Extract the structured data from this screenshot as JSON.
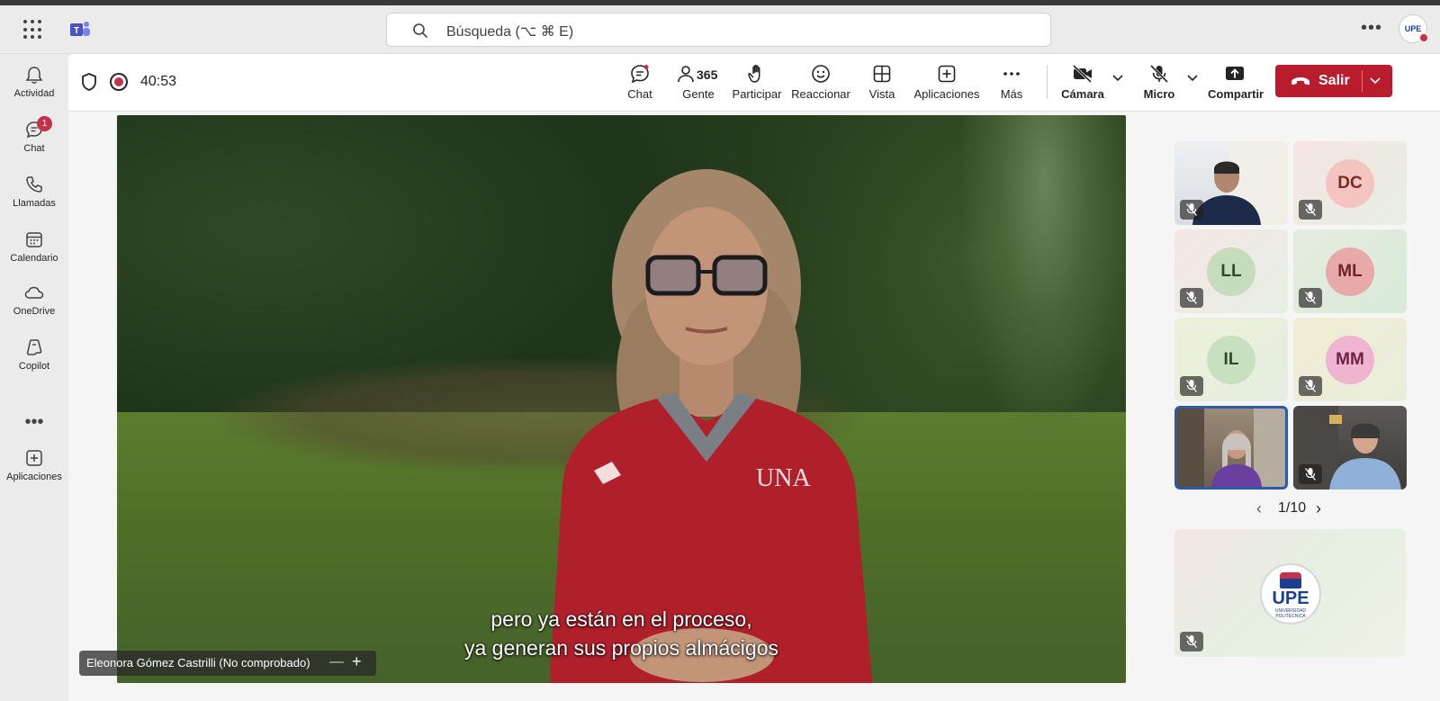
{
  "titlebar": {
    "search_placeholder": "Búsqueda (⌥ ⌘ E)",
    "more": "•••",
    "avatar_text": "UPE"
  },
  "rail": {
    "items": [
      {
        "label": "Actividad",
        "icon": "bell-icon"
      },
      {
        "label": "Chat",
        "icon": "chat-icon",
        "badge": "1"
      },
      {
        "label": "Llamadas",
        "icon": "phone-icon"
      },
      {
        "label": "Calendario",
        "icon": "calendar-icon"
      },
      {
        "label": "OneDrive",
        "icon": "cloud-icon"
      },
      {
        "label": "Copilot",
        "icon": "copilot-icon"
      },
      {
        "label": "Aplicaciones",
        "icon": "add-apps-icon"
      }
    ],
    "more": "•••"
  },
  "meeting": {
    "timer": "40:53",
    "toolbar": {
      "chat": "Chat",
      "people": "Gente",
      "people_count": "365",
      "raise": "Participar",
      "react": "Reaccionar",
      "view": "Vista",
      "apps": "Aplicaciones",
      "more": "Más",
      "camera": "Cámara",
      "mic": "Micro",
      "share": "Compartir",
      "leave": "Salir"
    },
    "main_video": {
      "caption_line1": "pero ya están en el proceso,",
      "caption_line2": "ya generan sus propios almácigos",
      "speaker_name": "Eleonora Gómez Castrilli (No comprobado)",
      "name_minus": "—",
      "name_plus": "+"
    },
    "participants": [
      {
        "type": "video",
        "muted": true
      },
      {
        "initials": "DC",
        "bg": "#f4c4c0",
        "fg": "#7a2a26",
        "muted": true
      },
      {
        "initials": "LL",
        "bg": "#c6dcbc",
        "fg": "#2f4a22",
        "muted": true
      },
      {
        "initials": "ML",
        "bg": "#e8a9a9",
        "fg": "#6e2424",
        "muted": true
      },
      {
        "initials": "IL",
        "bg": "#c9e0c0",
        "fg": "#2f4a22",
        "muted": true
      },
      {
        "initials": "MM",
        "bg": "#efb4cf",
        "fg": "#6d2346",
        "muted": true
      },
      {
        "type": "video",
        "selected": true
      },
      {
        "type": "video",
        "muted": true
      }
    ],
    "pager": {
      "prev": "‹",
      "text": "1/10",
      "next": "›"
    },
    "content_tile": {
      "logo_text": "UPE",
      "logo_subtext": "UNIVERSIDAD POLITECNICA"
    }
  }
}
